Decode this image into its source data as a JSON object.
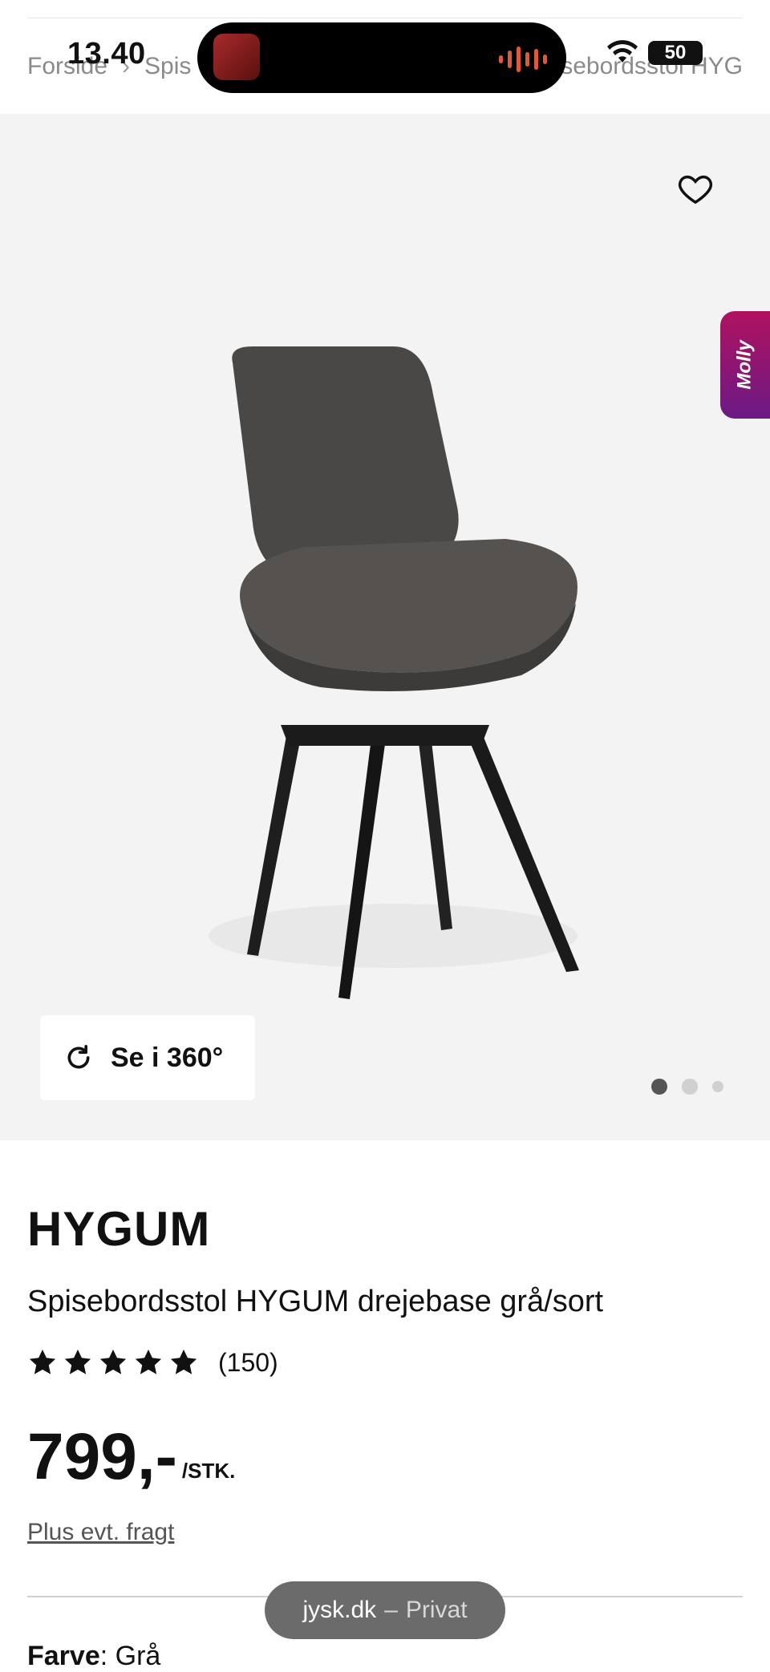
{
  "status": {
    "time": "13.40",
    "battery": "50"
  },
  "breadcrumb": {
    "home": "Forside",
    "category": "Spis",
    "current": "sebordsstol HYG"
  },
  "gallery": {
    "view360_label": "Se i 360°",
    "dots_total": 3,
    "dot_active_index": 0
  },
  "assistant": {
    "label": "Molly"
  },
  "product": {
    "brand": "HYGUM",
    "title": "Spisebordsstol HYGUM drejebase grå/sort",
    "rating_stars": 5,
    "reviews": "(150)",
    "price": "799,-",
    "unit": "/STK.",
    "freight": "Plus evt. fragt",
    "color_label": "Farve",
    "color_value": ": Grå"
  },
  "browser": {
    "domain": "jysk.dk",
    "separator": "–",
    "mode": "Privat"
  },
  "colors": {
    "hero_bg": "#f3f3f3",
    "molly_gradient_start": "#b0125e",
    "molly_gradient_end": "#6b1a86",
    "url_pill_bg": "#6b6b6b"
  }
}
